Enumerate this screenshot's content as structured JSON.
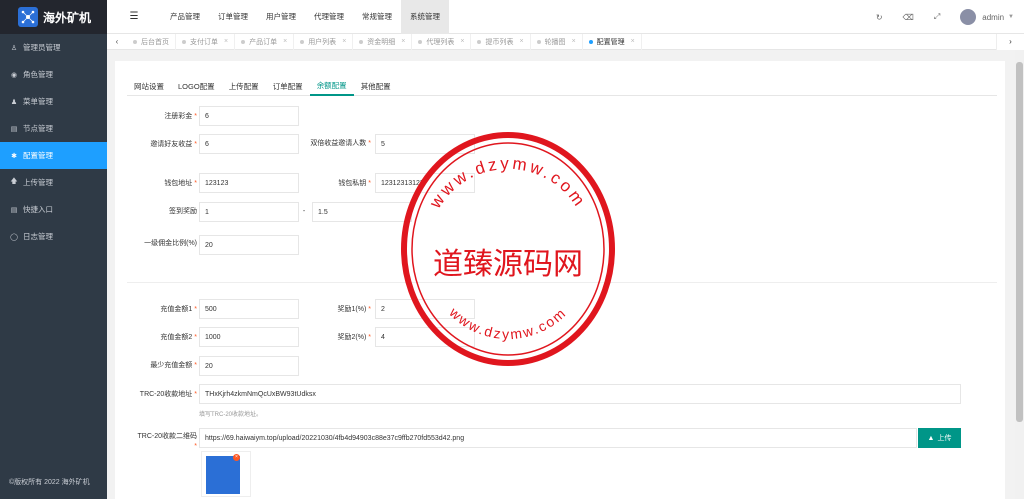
{
  "app": {
    "name": "海外矿机",
    "copyright": "©版权所有 2022 海外矿机"
  },
  "sidebar": {
    "items": [
      {
        "label": "管理员管理",
        "icon": "user-icon"
      },
      {
        "label": "角色管理",
        "icon": "role-icon"
      },
      {
        "label": "菜单管理",
        "icon": "menu-icon"
      },
      {
        "label": "节点管理",
        "icon": "node-icon"
      },
      {
        "label": "配置管理",
        "icon": "gear-icon",
        "active": true
      },
      {
        "label": "上传管理",
        "icon": "upload-icon"
      },
      {
        "label": "快捷入口",
        "icon": "shortcut-icon"
      },
      {
        "label": "日志管理",
        "icon": "log-icon"
      }
    ]
  },
  "topnav": {
    "items": [
      "产品管理",
      "订单管理",
      "用户管理",
      "代理管理",
      "常规管理",
      "系统管理"
    ],
    "active": "系统管理",
    "user": "admin"
  },
  "tabs": {
    "items": [
      {
        "label": "后台首页"
      },
      {
        "label": "支付订单"
      },
      {
        "label": "产品订单"
      },
      {
        "label": "用户列表"
      },
      {
        "label": "资金明细"
      },
      {
        "label": "代理列表"
      },
      {
        "label": "提币列表"
      },
      {
        "label": "轮播图"
      },
      {
        "label": "配置管理",
        "active": true
      }
    ]
  },
  "config_tabs": [
    "网站设置",
    "LOGO配置",
    "上传配置",
    "订单配置",
    "余额配置",
    "其他配置"
  ],
  "form": {
    "register_bonus_label": "注册彩金",
    "register_bonus_value": "6",
    "invite_reward_label": "邀请好友收益",
    "invite_reward_value": "6",
    "double_invite_label": "双倍收益邀请人数",
    "double_invite_value": "5",
    "wallet_address_label": "钱包地址",
    "wallet_address_value": "123123",
    "wallet_key_label": "钱包私钥",
    "wallet_key_value": "12312313123",
    "checkin_label": "签到奖励",
    "checkin_min": "1",
    "checkin_sep": "-",
    "checkin_max": "1.5",
    "commission_label": "一级佣金比例(%)",
    "commission_value": "20",
    "recharge1_label": "充值金额1",
    "recharge1_value": "500",
    "reward1_label": "奖励1(%)",
    "reward1_value": "2",
    "recharge2_label": "充值金额2",
    "recharge2_value": "1000",
    "reward2_label": "奖励2(%)",
    "reward2_value": "4",
    "min_recharge_label": "最少充值金额",
    "min_recharge_value": "20",
    "trc20_addr_label": "TRC-20收款地址",
    "trc20_addr_value": "THxKjrh4zkmNmQcUxBW93tUdksx",
    "trc20_addr_hint": "填写TRC-20收款地址。",
    "trc20_qr_label": "TRC-20收款二维码",
    "trc20_qr_value": "https://69.haiwaiym.top/upload/20221030/4fb4d94903c88e37c9ffb270fd553d42.png",
    "upload_label": "上传",
    "preview_badge": "×"
  },
  "watermark": {
    "center_text": "道臻源码网",
    "top_arc": "www.dzymw.com",
    "bottom_arc": "www.dzymw.com"
  },
  "colors": {
    "accent": "#009688",
    "sidebar_active": "#1e9fff",
    "required": "#ff5722",
    "stamp": "#e0161e"
  }
}
